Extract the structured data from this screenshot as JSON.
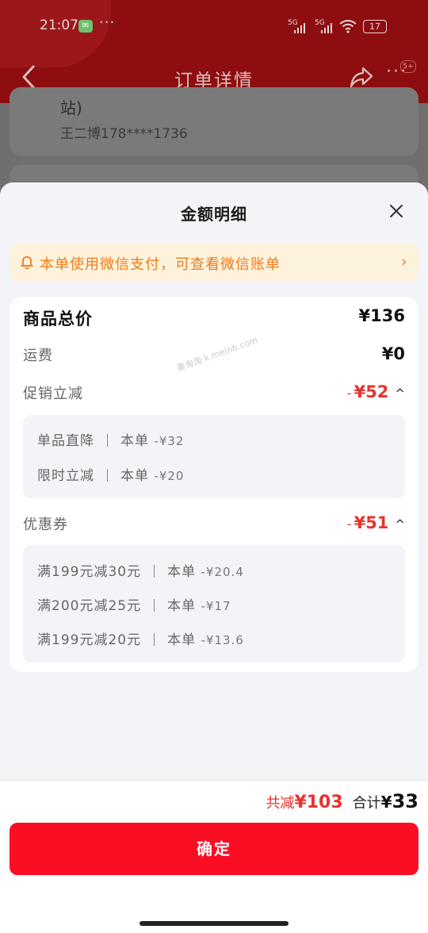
{
  "status_bar": {
    "time": "21:07",
    "dots": "···",
    "signal1": "5G",
    "signal2": "5G",
    "battery": "17"
  },
  "nav": {
    "title": "订单详情",
    "badge": "5+"
  },
  "background": {
    "address_tail": "站)",
    "contact": "王二博178****1736"
  },
  "sheet": {
    "title": "金额明细",
    "notice": "本单使用微信支付，可查看微信账单",
    "rows": {
      "goods_total": {
        "label": "商品总价",
        "value": "¥136"
      },
      "shipping": {
        "label": "运费",
        "value": "¥0"
      },
      "promotion": {
        "label": "促销立减",
        "minus": "-",
        "value": "¥52"
      },
      "coupon": {
        "label": "优惠券",
        "minus": "-",
        "value": "¥51"
      }
    },
    "promotion_details": [
      {
        "name": "单品直降",
        "scope": "本单",
        "amount": "-¥32"
      },
      {
        "name": "限时立减",
        "scope": "本单",
        "amount": "-¥20"
      }
    ],
    "coupon_details": [
      {
        "name": "满199元减30元",
        "scope": "本单",
        "amount": "-¥20.4"
      },
      {
        "name": "满200元减25元",
        "scope": "本单",
        "amount": "-¥17"
      },
      {
        "name": "满199元减20元",
        "scope": "本单",
        "amount": "-¥13.6"
      }
    ],
    "watermark": "美淘淘 k.meinb.com"
  },
  "footer": {
    "saved_label": "共减",
    "saved_amount": "¥103",
    "total_label": "合计",
    "total_currency": "¥",
    "total_amount": "33",
    "confirm_label": "确定"
  },
  "colors": {
    "accent_red": "#e8322c",
    "button_red": "#fb0d24",
    "notice_bg": "#fdf2dc",
    "notice_text": "#f07d1b"
  }
}
